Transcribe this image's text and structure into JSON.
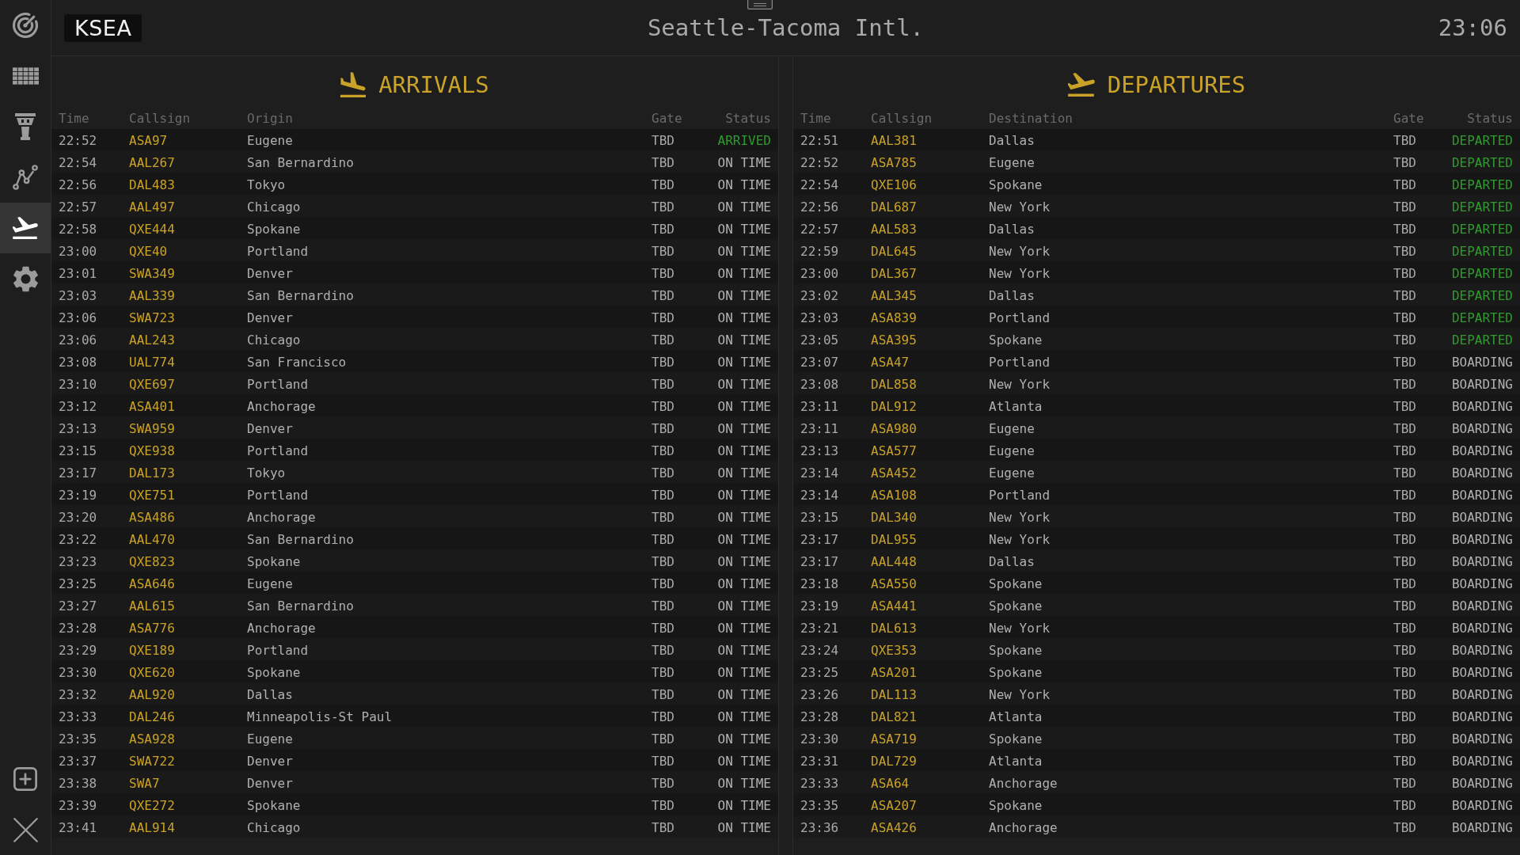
{
  "nav": [
    {
      "selected": false
    },
    {
      "selected": false
    },
    {
      "selected": false
    },
    {
      "selected": false
    },
    {
      "selected": true
    },
    {
      "selected": false
    }
  ],
  "header": {
    "airport_code": "KSEA",
    "airport_name": "Seattle-Tacoma Intl.",
    "clock": "23:06"
  },
  "boards": [
    {
      "kind": "arrivals",
      "title": "ARRIVALS",
      "columns": [
        "Time",
        "Callsign",
        "Origin",
        "Gate",
        "Status"
      ],
      "rows": [
        {
          "time": "22:52",
          "callsign": "ASA97",
          "city": "Eugene",
          "gate": "TBD",
          "status": "ARRIVED",
          "completed": true
        },
        {
          "time": "22:54",
          "callsign": "AAL267",
          "city": "San Bernardino",
          "gate": "TBD",
          "status": "ON TIME",
          "completed": false
        },
        {
          "time": "22:56",
          "callsign": "DAL483",
          "city": "Tokyo",
          "gate": "TBD",
          "status": "ON TIME",
          "completed": false
        },
        {
          "time": "22:57",
          "callsign": "AAL497",
          "city": "Chicago",
          "gate": "TBD",
          "status": "ON TIME",
          "completed": false
        },
        {
          "time": "22:58",
          "callsign": "QXE444",
          "city": "Spokane",
          "gate": "TBD",
          "status": "ON TIME",
          "completed": false
        },
        {
          "time": "23:00",
          "callsign": "QXE40",
          "city": "Portland",
          "gate": "TBD",
          "status": "ON TIME",
          "completed": false
        },
        {
          "time": "23:01",
          "callsign": "SWA349",
          "city": "Denver",
          "gate": "TBD",
          "status": "ON TIME",
          "completed": false
        },
        {
          "time": "23:03",
          "callsign": "AAL339",
          "city": "San Bernardino",
          "gate": "TBD",
          "status": "ON TIME",
          "completed": false
        },
        {
          "time": "23:06",
          "callsign": "SWA723",
          "city": "Denver",
          "gate": "TBD",
          "status": "ON TIME",
          "completed": false
        },
        {
          "time": "23:06",
          "callsign": "AAL243",
          "city": "Chicago",
          "gate": "TBD",
          "status": "ON TIME",
          "completed": false
        },
        {
          "time": "23:08",
          "callsign": "UAL774",
          "city": "San Francisco",
          "gate": "TBD",
          "status": "ON TIME",
          "completed": false
        },
        {
          "time": "23:10",
          "callsign": "QXE697",
          "city": "Portland",
          "gate": "TBD",
          "status": "ON TIME",
          "completed": false
        },
        {
          "time": "23:12",
          "callsign": "ASA401",
          "city": "Anchorage",
          "gate": "TBD",
          "status": "ON TIME",
          "completed": false
        },
        {
          "time": "23:13",
          "callsign": "SWA959",
          "city": "Denver",
          "gate": "TBD",
          "status": "ON TIME",
          "completed": false
        },
        {
          "time": "23:15",
          "callsign": "QXE938",
          "city": "Portland",
          "gate": "TBD",
          "status": "ON TIME",
          "completed": false
        },
        {
          "time": "23:17",
          "callsign": "DAL173",
          "city": "Tokyo",
          "gate": "TBD",
          "status": "ON TIME",
          "completed": false
        },
        {
          "time": "23:19",
          "callsign": "QXE751",
          "city": "Portland",
          "gate": "TBD",
          "status": "ON TIME",
          "completed": false
        },
        {
          "time": "23:20",
          "callsign": "ASA486",
          "city": "Anchorage",
          "gate": "TBD",
          "status": "ON TIME",
          "completed": false
        },
        {
          "time": "23:22",
          "callsign": "AAL470",
          "city": "San Bernardino",
          "gate": "TBD",
          "status": "ON TIME",
          "completed": false
        },
        {
          "time": "23:23",
          "callsign": "QXE823",
          "city": "Spokane",
          "gate": "TBD",
          "status": "ON TIME",
          "completed": false
        },
        {
          "time": "23:25",
          "callsign": "ASA646",
          "city": "Eugene",
          "gate": "TBD",
          "status": "ON TIME",
          "completed": false
        },
        {
          "time": "23:27",
          "callsign": "AAL615",
          "city": "San Bernardino",
          "gate": "TBD",
          "status": "ON TIME",
          "completed": false
        },
        {
          "time": "23:28",
          "callsign": "ASA776",
          "city": "Anchorage",
          "gate": "TBD",
          "status": "ON TIME",
          "completed": false
        },
        {
          "time": "23:29",
          "callsign": "QXE189",
          "city": "Portland",
          "gate": "TBD",
          "status": "ON TIME",
          "completed": false
        },
        {
          "time": "23:30",
          "callsign": "QXE620",
          "city": "Spokane",
          "gate": "TBD",
          "status": "ON TIME",
          "completed": false
        },
        {
          "time": "23:32",
          "callsign": "AAL920",
          "city": "Dallas",
          "gate": "TBD",
          "status": "ON TIME",
          "completed": false
        },
        {
          "time": "23:33",
          "callsign": "DAL246",
          "city": "Minneapolis-St Paul",
          "gate": "TBD",
          "status": "ON TIME",
          "completed": false
        },
        {
          "time": "23:35",
          "callsign": "ASA928",
          "city": "Eugene",
          "gate": "TBD",
          "status": "ON TIME",
          "completed": false
        },
        {
          "time": "23:37",
          "callsign": "SWA722",
          "city": "Denver",
          "gate": "TBD",
          "status": "ON TIME",
          "completed": false
        },
        {
          "time": "23:38",
          "callsign": "SWA7",
          "city": "Denver",
          "gate": "TBD",
          "status": "ON TIME",
          "completed": false
        },
        {
          "time": "23:39",
          "callsign": "QXE272",
          "city": "Spokane",
          "gate": "TBD",
          "status": "ON TIME",
          "completed": false
        },
        {
          "time": "23:41",
          "callsign": "AAL914",
          "city": "Chicago",
          "gate": "TBD",
          "status": "ON TIME",
          "completed": false
        }
      ]
    },
    {
      "kind": "departures",
      "title": "DEPARTURES",
      "columns": [
        "Time",
        "Callsign",
        "Destination",
        "Gate",
        "Status"
      ],
      "rows": [
        {
          "time": "22:51",
          "callsign": "AAL381",
          "city": "Dallas",
          "gate": "TBD",
          "status": "DEPARTED",
          "completed": true
        },
        {
          "time": "22:52",
          "callsign": "ASA785",
          "city": "Eugene",
          "gate": "TBD",
          "status": "DEPARTED",
          "completed": true
        },
        {
          "time": "22:54",
          "callsign": "QXE106",
          "city": "Spokane",
          "gate": "TBD",
          "status": "DEPARTED",
          "completed": true
        },
        {
          "time": "22:56",
          "callsign": "DAL687",
          "city": "New York",
          "gate": "TBD",
          "status": "DEPARTED",
          "completed": true
        },
        {
          "time": "22:57",
          "callsign": "AAL583",
          "city": "Dallas",
          "gate": "TBD",
          "status": "DEPARTED",
          "completed": true
        },
        {
          "time": "22:59",
          "callsign": "DAL645",
          "city": "New York",
          "gate": "TBD",
          "status": "DEPARTED",
          "completed": true
        },
        {
          "time": "23:00",
          "callsign": "DAL367",
          "city": "New York",
          "gate": "TBD",
          "status": "DEPARTED",
          "completed": true
        },
        {
          "time": "23:02",
          "callsign": "AAL345",
          "city": "Dallas",
          "gate": "TBD",
          "status": "DEPARTED",
          "completed": true
        },
        {
          "time": "23:03",
          "callsign": "ASA839",
          "city": "Portland",
          "gate": "TBD",
          "status": "DEPARTED",
          "completed": true
        },
        {
          "time": "23:05",
          "callsign": "ASA395",
          "city": "Spokane",
          "gate": "TBD",
          "status": "DEPARTED",
          "completed": true
        },
        {
          "time": "23:07",
          "callsign": "ASA47",
          "city": "Portland",
          "gate": "TBD",
          "status": "BOARDING",
          "completed": false
        },
        {
          "time": "23:08",
          "callsign": "DAL858",
          "city": "New York",
          "gate": "TBD",
          "status": "BOARDING",
          "completed": false
        },
        {
          "time": "23:11",
          "callsign": "DAL912",
          "city": "Atlanta",
          "gate": "TBD",
          "status": "BOARDING",
          "completed": false
        },
        {
          "time": "23:11",
          "callsign": "ASA980",
          "city": "Eugene",
          "gate": "TBD",
          "status": "BOARDING",
          "completed": false
        },
        {
          "time": "23:13",
          "callsign": "ASA577",
          "city": "Eugene",
          "gate": "TBD",
          "status": "BOARDING",
          "completed": false
        },
        {
          "time": "23:14",
          "callsign": "ASA452",
          "city": "Eugene",
          "gate": "TBD",
          "status": "BOARDING",
          "completed": false
        },
        {
          "time": "23:14",
          "callsign": "ASA108",
          "city": "Portland",
          "gate": "TBD",
          "status": "BOARDING",
          "completed": false
        },
        {
          "time": "23:15",
          "callsign": "DAL340",
          "city": "New York",
          "gate": "TBD",
          "status": "BOARDING",
          "completed": false
        },
        {
          "time": "23:17",
          "callsign": "DAL955",
          "city": "New York",
          "gate": "TBD",
          "status": "BOARDING",
          "completed": false
        },
        {
          "time": "23:17",
          "callsign": "AAL448",
          "city": "Dallas",
          "gate": "TBD",
          "status": "BOARDING",
          "completed": false
        },
        {
          "time": "23:18",
          "callsign": "ASA550",
          "city": "Spokane",
          "gate": "TBD",
          "status": "BOARDING",
          "completed": false
        },
        {
          "time": "23:19",
          "callsign": "ASA441",
          "city": "Spokane",
          "gate": "TBD",
          "status": "BOARDING",
          "completed": false
        },
        {
          "time": "23:21",
          "callsign": "DAL613",
          "city": "New York",
          "gate": "TBD",
          "status": "BOARDING",
          "completed": false
        },
        {
          "time": "23:24",
          "callsign": "QXE353",
          "city": "Spokane",
          "gate": "TBD",
          "status": "BOARDING",
          "completed": false
        },
        {
          "time": "23:25",
          "callsign": "ASA201",
          "city": "Spokane",
          "gate": "TBD",
          "status": "BOARDING",
          "completed": false
        },
        {
          "time": "23:26",
          "callsign": "DAL113",
          "city": "New York",
          "gate": "TBD",
          "status": "BOARDING",
          "completed": false
        },
        {
          "time": "23:28",
          "callsign": "DAL821",
          "city": "Atlanta",
          "gate": "TBD",
          "status": "BOARDING",
          "completed": false
        },
        {
          "time": "23:30",
          "callsign": "ASA719",
          "city": "Spokane",
          "gate": "TBD",
          "status": "BOARDING",
          "completed": false
        },
        {
          "time": "23:31",
          "callsign": "DAL729",
          "city": "Atlanta",
          "gate": "TBD",
          "status": "BOARDING",
          "completed": false
        },
        {
          "time": "23:33",
          "callsign": "ASA64",
          "city": "Anchorage",
          "gate": "TBD",
          "status": "BOARDING",
          "completed": false
        },
        {
          "time": "23:35",
          "callsign": "ASA207",
          "city": "Spokane",
          "gate": "TBD",
          "status": "BOARDING",
          "completed": false
        },
        {
          "time": "23:36",
          "callsign": "ASA426",
          "city": "Anchorage",
          "gate": "TBD",
          "status": "BOARDING",
          "completed": false
        }
      ]
    }
  ]
}
